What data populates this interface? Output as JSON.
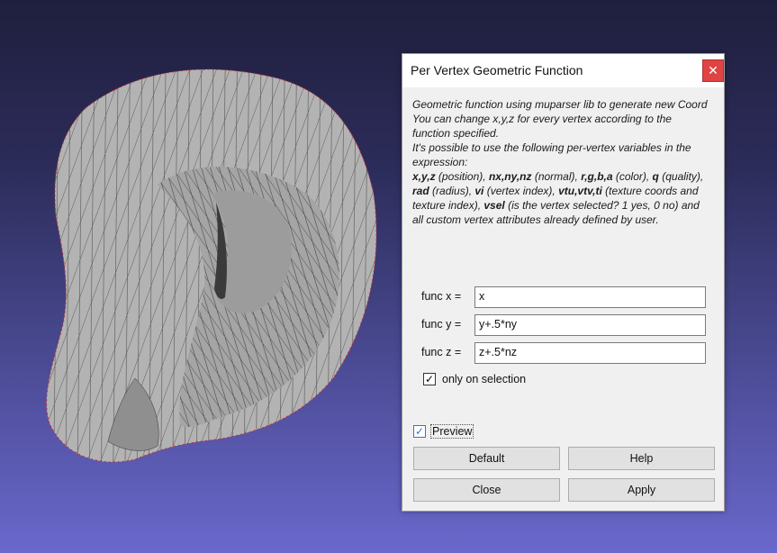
{
  "dialog": {
    "title": "Per Vertex Geometric Function",
    "close_glyph": "✕",
    "description": {
      "line1": "Geometric function using muparser lib to generate new Coord",
      "line2": "You can change x,y,z for every vertex according to the function specified.",
      "line3": "It's possible to use the following per-vertex variables in the expression:",
      "vars": {
        "xyz": "x,y,z",
        "xyz_desc": " (position), ",
        "n": "nx,ny,nz",
        "n_desc": " (normal), ",
        "rgba": "r,g,b,a",
        "rgba_desc": " (color), ",
        "q": "q",
        "q_desc": " (quality), ",
        "rad": "rad",
        "rad_desc": " (radius), ",
        "vi": "vi",
        "vi_desc": " (vertex index), ",
        "vt": "vtu,vtv,ti",
        "vt_desc": " (texture coords and texture index), ",
        "vsel": "vsel",
        "vsel_desc": " (is the vertex selected? 1 yes, 0 no) and all custom vertex attributes already defined by user."
      }
    },
    "fields": [
      {
        "label": "func x =",
        "value": "x"
      },
      {
        "label": "func y =",
        "value": "y+.5*ny"
      },
      {
        "label": "func z =",
        "value": "z+.5*nz"
      }
    ],
    "only_on_selection": {
      "label": "only on selection",
      "checked": true
    },
    "preview": {
      "label": "Preview",
      "checked": true
    },
    "buttons": {
      "default": "Default",
      "help": "Help",
      "close": "Close",
      "apply": "Apply"
    },
    "check_glyph": "✓"
  },
  "colors": {
    "bg_top": "#1f1f3e",
    "bg_bottom": "#6a68cc",
    "mesh": "#b0b0b0",
    "close_button": "#e04343"
  }
}
